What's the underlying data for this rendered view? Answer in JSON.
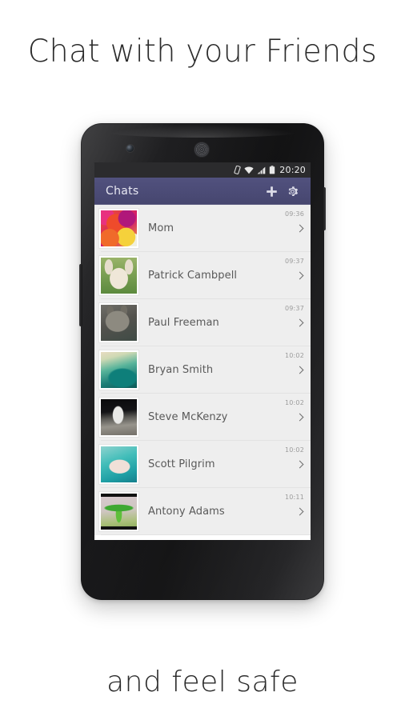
{
  "page": {
    "headline": "Chat with your Friends",
    "footer_caption": "and feel safe",
    "background_color": "#ffffff"
  },
  "phone": {
    "hardware": {
      "front_camera": "front-camera",
      "earpiece": "earpiece-speaker",
      "volume_button": "volume-rocker",
      "power_button": "power-button"
    }
  },
  "status_bar": {
    "background_color": "#2b2b2d",
    "time": "20:20",
    "icons": [
      "vibrate-icon",
      "wifi-icon",
      "signal-icon",
      "battery-icon"
    ]
  },
  "app_bar": {
    "title": "Chats",
    "background_color": "#4b4b76",
    "actions": [
      {
        "name": "add-chat-button",
        "icon": "plus-icon"
      },
      {
        "name": "settings-button",
        "icon": "gear-icon"
      }
    ]
  },
  "chat_list": {
    "rows": [
      {
        "name": "Mom",
        "time": "09:36",
        "avatar": "roses-photo",
        "avatar_class": "av-roses"
      },
      {
        "name": "Patrick Cambpell",
        "time": "09:37",
        "avatar": "bulldog-photo",
        "avatar_class": "av-dog"
      },
      {
        "name": "Paul Freeman",
        "time": "09:37",
        "avatar": "cat-photo",
        "avatar_class": "av-cat"
      },
      {
        "name": "Bryan Smith",
        "time": "10:02",
        "avatar": "surf-wave-photo",
        "avatar_class": "av-wave"
      },
      {
        "name": "Steve McKenzy",
        "time": "10:02",
        "avatar": "astronaut-photo",
        "avatar_class": "av-moon"
      },
      {
        "name": "Scott Pilgrim",
        "time": "10:02",
        "avatar": "pig-swim-photo",
        "avatar_class": "av-pig"
      },
      {
        "name": "Antony Adams",
        "time": "10:11",
        "avatar": "green-bird-photo",
        "avatar_class": "av-bird"
      }
    ],
    "row_background_color": "#eeeeee",
    "name_color": "#595959",
    "time_color": "#9b9b9b"
  }
}
